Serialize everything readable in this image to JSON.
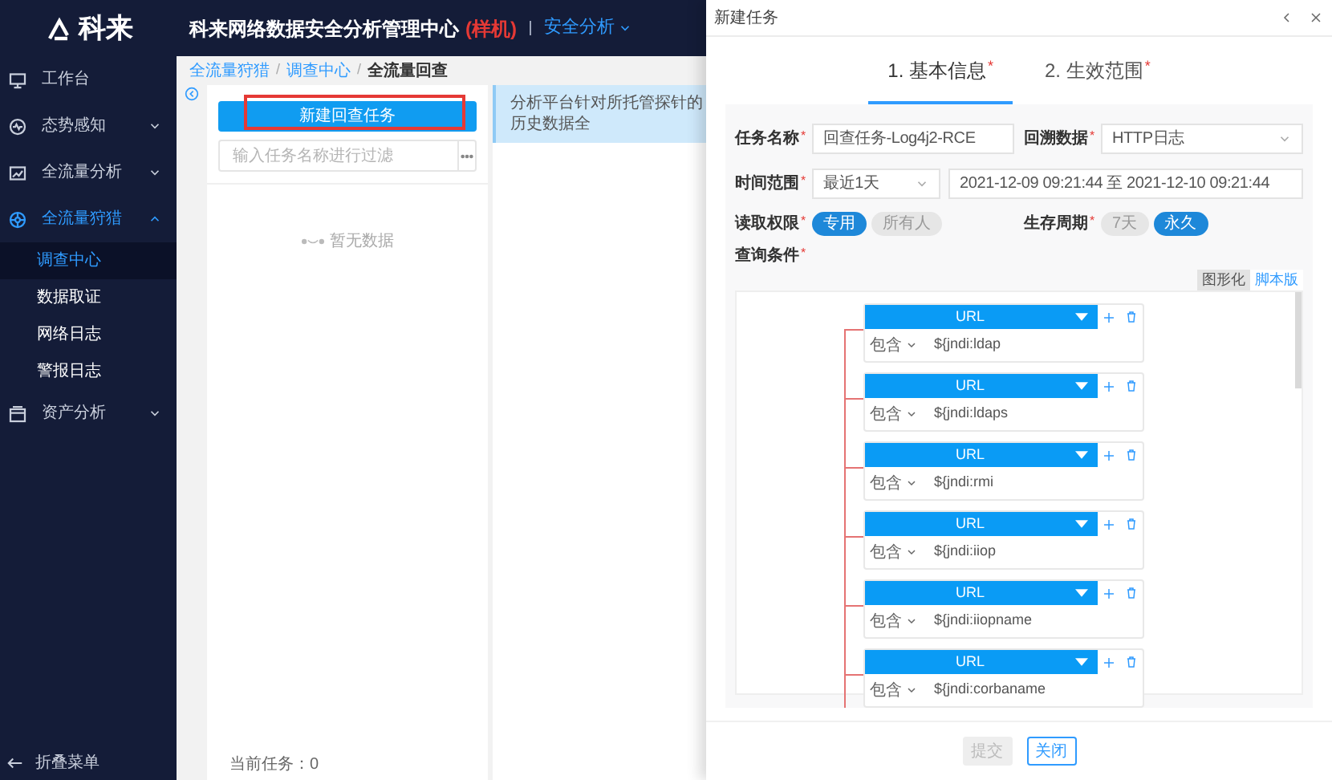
{
  "sidebar": {
    "logo": "科来",
    "items": [
      {
        "label": "工作台",
        "kind": "link"
      },
      {
        "label": "态势感知",
        "kind": "group",
        "expanded": false
      },
      {
        "label": "全流量分析",
        "kind": "group",
        "expanded": false
      },
      {
        "label": "全流量狩猎",
        "kind": "group",
        "expanded": true,
        "children": [
          {
            "label": "调查中心",
            "selected": true
          },
          {
            "label": "数据取证",
            "selected": false
          },
          {
            "label": "网络日志",
            "selected": false
          },
          {
            "label": "警报日志",
            "selected": false
          }
        ]
      },
      {
        "label": "资产分析",
        "kind": "group",
        "expanded": false
      }
    ],
    "collapse": "折叠菜单"
  },
  "header": {
    "title": "科来网络数据安全分析管理中心",
    "badge": "(样机)",
    "module": "安全分析"
  },
  "breadcrumb": {
    "items": [
      {
        "label": "全流量狩猎",
        "kind": "link"
      },
      {
        "label": "调查中心",
        "kind": "link"
      },
      {
        "label": "全流量回查",
        "kind": "current"
      }
    ],
    "separators": [
      "/",
      "/"
    ]
  },
  "task_panel": {
    "new_button": {
      "label": "新建回查任务",
      "highlighted": true
    },
    "filter": {
      "placeholder": "输入任务名称进行过滤"
    },
    "empty": "暂无数据",
    "footer": "当前任务：0"
  },
  "info": {
    "text": "分析平台针对所托管探针的历史数据全"
  },
  "dialog": {
    "title": "新建任务",
    "tabs": [
      {
        "label": "1. 基本信息",
        "mark": "*",
        "selected": true
      },
      {
        "label": "2. 生效范围",
        "mark": "*",
        "selected": false
      }
    ],
    "task_name": {
      "label": "任务名称",
      "mark": "*",
      "value": "回查任务-Log4j2-RCE"
    },
    "source": {
      "label": "回溯数据",
      "mark": "*",
      "value": "HTTP日志"
    },
    "time_range": {
      "label": "时间范围",
      "mark": "*",
      "value": "最近1天",
      "range": "2021-12-09 09:21:44 至 2021-12-10 09:21:44"
    },
    "permission": {
      "label": "读取权限",
      "mark": "*",
      "options": [
        {
          "label": "专用",
          "selected": true
        },
        {
          "label": "所有人",
          "selected": false
        }
      ]
    },
    "lifetime": {
      "label": "生存周期",
      "mark": "*",
      "options": [
        {
          "label": "7天",
          "selected": false
        },
        {
          "label": "永久",
          "selected": true
        }
      ]
    },
    "query": {
      "label": "查询条件",
      "mark": "*",
      "modes": [
        {
          "label": "图形化",
          "selected": true
        },
        {
          "label": "脚本版",
          "selected": false
        }
      ],
      "conditions": [
        {
          "field": "URL",
          "operator": "包含",
          "value": "${jndi:ldap"
        },
        {
          "field": "URL",
          "operator": "包含",
          "value": "${jndi:ldaps"
        },
        {
          "field": "URL",
          "operator": "包含",
          "value": "${jndi:rmi"
        },
        {
          "field": "URL",
          "operator": "包含",
          "value": "${jndi:iiop"
        },
        {
          "field": "URL",
          "operator": "包含",
          "value": "${jndi:iiopname"
        },
        {
          "field": "URL",
          "operator": "包含",
          "value": "${jndi:corbaname"
        }
      ]
    },
    "buttons": [
      {
        "label": "提交",
        "disabled": true
      },
      {
        "label": "关闭",
        "disabled": false
      }
    ]
  }
}
